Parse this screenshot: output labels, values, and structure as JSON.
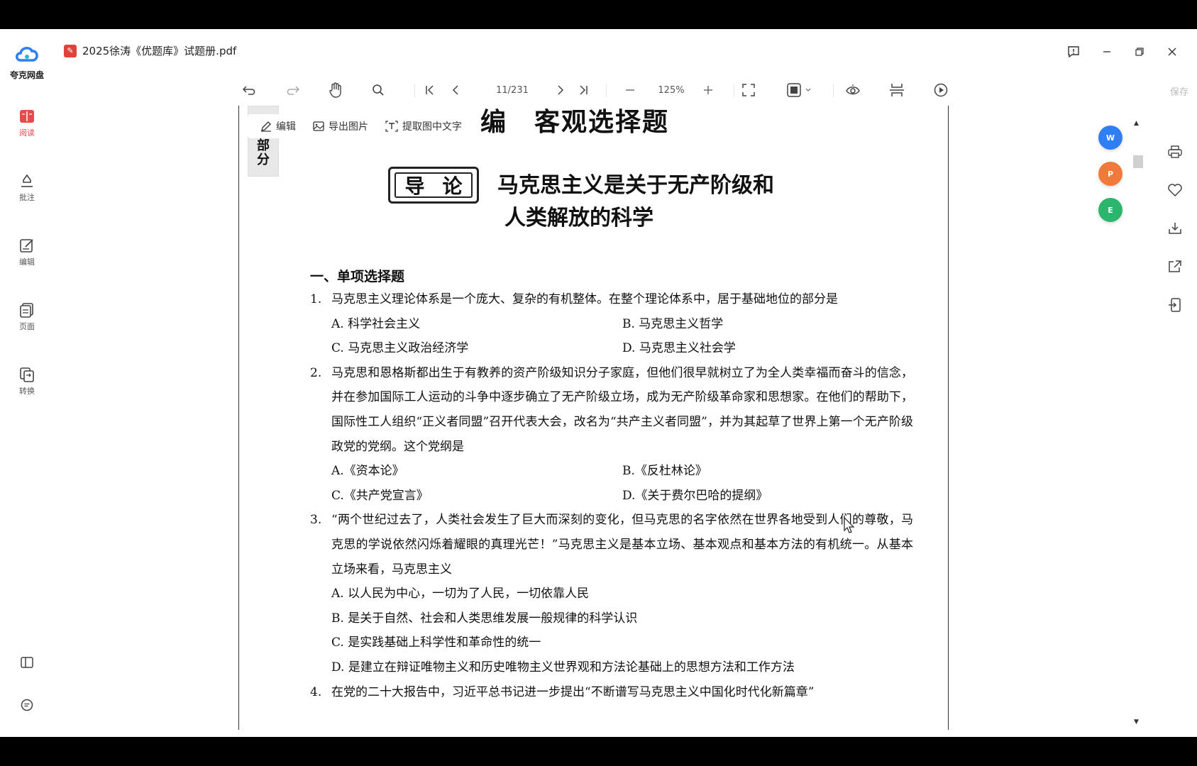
{
  "app": {
    "logo_text": "夸克网盘",
    "nav": [
      {
        "label": "阅读",
        "icon": "book-icon"
      },
      {
        "label": "批注",
        "icon": "pen-icon"
      },
      {
        "label": "编辑",
        "icon": "edit-icon"
      },
      {
        "label": "页面",
        "icon": "pages-icon"
      },
      {
        "label": "转换",
        "icon": "convert-icon"
      }
    ],
    "accent": "#e54b4b"
  },
  "titlebar": {
    "file_name": "2025徐涛《优题库》试题册.pdf"
  },
  "toolbar": {
    "page_indicator": "11/231",
    "zoom": "125%",
    "save_label": "保存"
  },
  "context_bar": {
    "edit": "编辑",
    "export_image": "导出图片",
    "extract_text": "提取图中文字"
  },
  "document": {
    "side_tab": "部\n分",
    "part_title": "编　客观选择题",
    "chalk_left": "导",
    "chalk_right": "论",
    "chapter_title_1": "马克思主义是关于无产阶级和",
    "chapter_title_2": "人类解放的科学",
    "section_heading": "一、单项选择题",
    "questions": [
      {
        "num": "1.",
        "text": "马克思主义理论体系是一个庞大、复杂的有机整体。在整个理论体系中，居于基础地位的部分是",
        "options": [
          "A.  科学社会主义",
          "B.  马克思主义哲学",
          "C.  马克思主义政治经济学",
          "D.  马克思主义社会学"
        ]
      },
      {
        "num": "2.",
        "text": "马克思和恩格斯都出生于有教养的资产阶级知识分子家庭，但他们很早就树立了为全人类幸福而奋斗的信念，并在参加国际工人运动的斗争中逐步确立了无产阶级立场，成为无产阶级革命家和思想家。在他们的帮助下，国际性工人组织“正义者同盟”召开代表大会，改名为“共产主义者同盟”，并为其起草了世界上第一个无产阶级政党的党纲。这个党纲是",
        "options": [
          "A.《资本论》",
          "B.《反杜林论》",
          "C.《共产党宣言》",
          "D.《关于费尔巴哈的提纲》"
        ]
      },
      {
        "num": "3.",
        "text": "“两个世纪过去了，人类社会发生了巨大而深刻的变化，但马克思的名字依然在世界各地受到人们的尊敬，马克思的学说依然闪烁着耀眼的真理光芒！”马克思主义是基本立场、基本观点和基本方法的有机统一。从基本立场来看，马克思主义",
        "options": [
          "A.  以人民为中心，一切为了人民，一切依靠人民",
          "B.  是关于自然、社会和人类思维发展一般规律的科学认识",
          "C.  是实践基础上科学性和革命性的统一",
          "D.  是建立在辩证唯物主义和历史唯物主义世界观和方法论基础上的思想方法和工作方法"
        ]
      },
      {
        "num": "4.",
        "text": "在党的二十大报告中，习近平总书记进一步提出“不断谱写马克思主义中国化时代化新篇章”",
        "options": []
      }
    ]
  },
  "float_buttons": [
    {
      "label": "W",
      "color": "#2f7ef5"
    },
    {
      "label": "P",
      "color": "#f07a3c"
    },
    {
      "label": "E",
      "color": "#2bb56d"
    }
  ]
}
